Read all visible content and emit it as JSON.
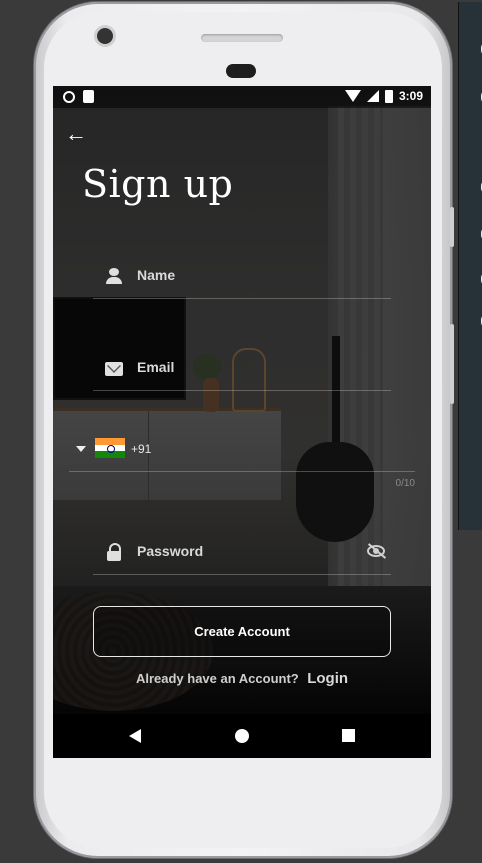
{
  "status_bar": {
    "time": "3:09"
  },
  "header": {
    "back_icon": "arrow-left-icon",
    "title": "Sign up"
  },
  "form": {
    "name": {
      "placeholder": "Name",
      "icon": "person-icon"
    },
    "email": {
      "placeholder": "Email",
      "icon": "mail-icon"
    },
    "phone": {
      "country_code": "+91",
      "flag": "india-flag",
      "counter": "0/10"
    },
    "password": {
      "placeholder": "Password",
      "icon": "lock-icon",
      "toggle_icon": "eye-off-icon"
    }
  },
  "actions": {
    "create_account_label": "Create Account",
    "login_prompt": "Already have an Account?",
    "login_link": "Login"
  },
  "colors": {
    "text": "#ffffff",
    "muted": "#cfcfcf",
    "nav_bg": "#000000"
  }
}
